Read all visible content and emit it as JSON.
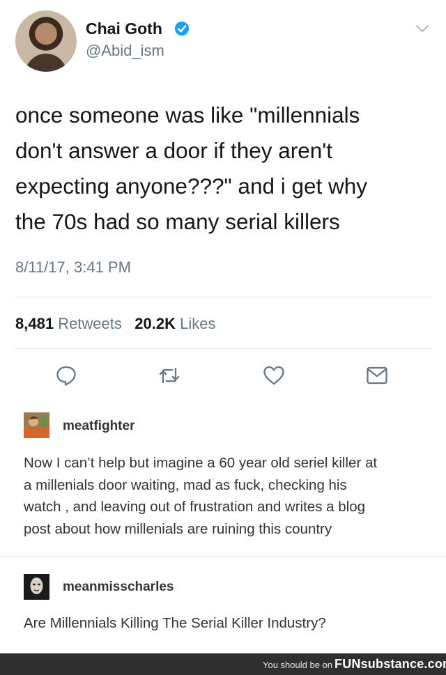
{
  "tweet": {
    "display_name": "Chai Goth",
    "handle": "@Abid_ism",
    "text_lines": [
      "once someone was like \"millennials",
      "don't answer a door if they aren't",
      "expecting anyone???\" and i get why",
      "the 70s had so many serial killers"
    ],
    "timestamp": "8/11/17, 3:41 PM",
    "retweet_count": "8,481",
    "retweet_label": "Retweets",
    "like_count": "20.2K",
    "like_label": "Likes",
    "icons": [
      "verified-badge-icon",
      "chevron-down-icon",
      "reply-icon",
      "retweet-icon",
      "like-icon",
      "message-icon"
    ],
    "accent_color": "#1da1f2"
  },
  "posts": [
    {
      "username": "meatfighter",
      "body_lines": [
        "Now I can’t help but imagine a 60 year old seriel killer at",
        "a millenials door waiting, mad as fuck, checking his",
        "watch , and leaving out of frustration and writes a blog",
        "post about how millenials are ruining this country"
      ]
    },
    {
      "username": "meanmisscharles",
      "body_lines": [
        "Are Millennials Killing The Serial Killer Industry?"
      ]
    }
  ],
  "footer": {
    "prefix": "You should be on",
    "brand": "FUNsubstance.com"
  }
}
